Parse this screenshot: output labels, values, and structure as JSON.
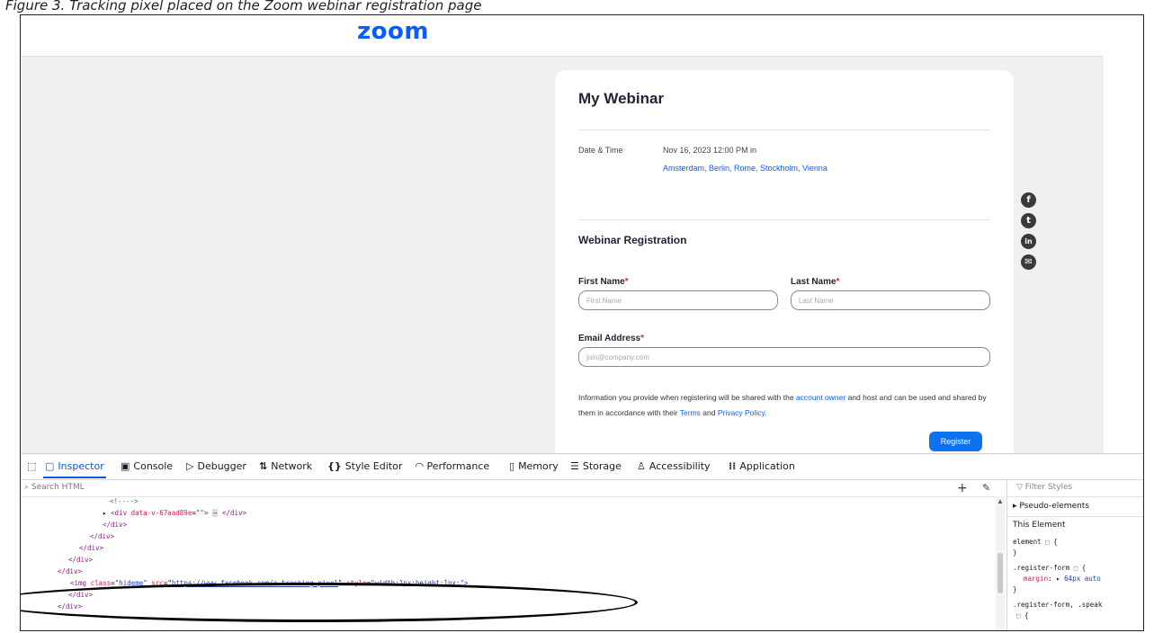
{
  "caption": "Figure 3. Tracking pixel placed on the Zoom webinar registration page",
  "logo": "zoom",
  "webinar": {
    "title": "My Webinar",
    "date_label": "Date & Time",
    "date_value": "Nov 16, 2023 12:00 PM in",
    "timezone": "Amsterdam, Berlin, Rome, Stockholm, Vienna",
    "registration_title": "Webinar Registration",
    "first_name_label": "First Name",
    "last_name_label": "Last Name",
    "email_label": "Email Address",
    "required_mark": "*",
    "first_name_placeholder": "First Name",
    "last_name_placeholder": "Last Name",
    "email_placeholder": "join@company.com",
    "info_part1": "Information you provide when registering will be shared with the ",
    "info_link1": "account owner",
    "info_part2": " and host and can be used and shared by them in accordance with their ",
    "info_link2": "Terms",
    "info_part3": " and ",
    "info_link3": "Privacy Policy",
    "info_part4": ".",
    "register_label": "Register"
  },
  "social": [
    {
      "icon": "facebook-icon",
      "glyph": "f"
    },
    {
      "icon": "twitter-icon",
      "glyph": "t"
    },
    {
      "icon": "linkedin-icon",
      "glyph": "in"
    },
    {
      "icon": "mail-icon",
      "glyph": "✉"
    }
  ],
  "devtools": {
    "tabs": [
      "Inspector",
      "Console",
      "Debugger",
      "Network",
      "Style Editor",
      "Performance",
      "Memory",
      "Storage",
      "Accessibility",
      "Application"
    ],
    "active_tab": "Inspector",
    "search_placeholder": "Search HTML",
    "filter_placeholder": "Filter Styles",
    "html_lines": {
      "comment": "<!---->",
      "div_open": "<div",
      "div_attr": "data-v-67aad89e",
      "div_val": "\"\"",
      "div_ellipsis": "⋯",
      "div_close": "</div>",
      "img_open": "<img",
      "img_class_attr": "class",
      "img_class_val": "\"hideme\"",
      "img_src_attr": "src",
      "img_src_val": "https://www.facebook.com/a-tracking-pixel",
      "img_style_attr": "style",
      "img_style_val": "\"width:1px;height:1px;\"",
      "img_end": ">"
    },
    "rules": {
      "pseudo": "Pseudo-elements",
      "this_element": "This Element",
      "element_rule": "element",
      "register_form": ".register-form",
      "margin_prop": "margin",
      "margin_val": "64px auto",
      "register_form2": ".register-form, .speak"
    }
  }
}
